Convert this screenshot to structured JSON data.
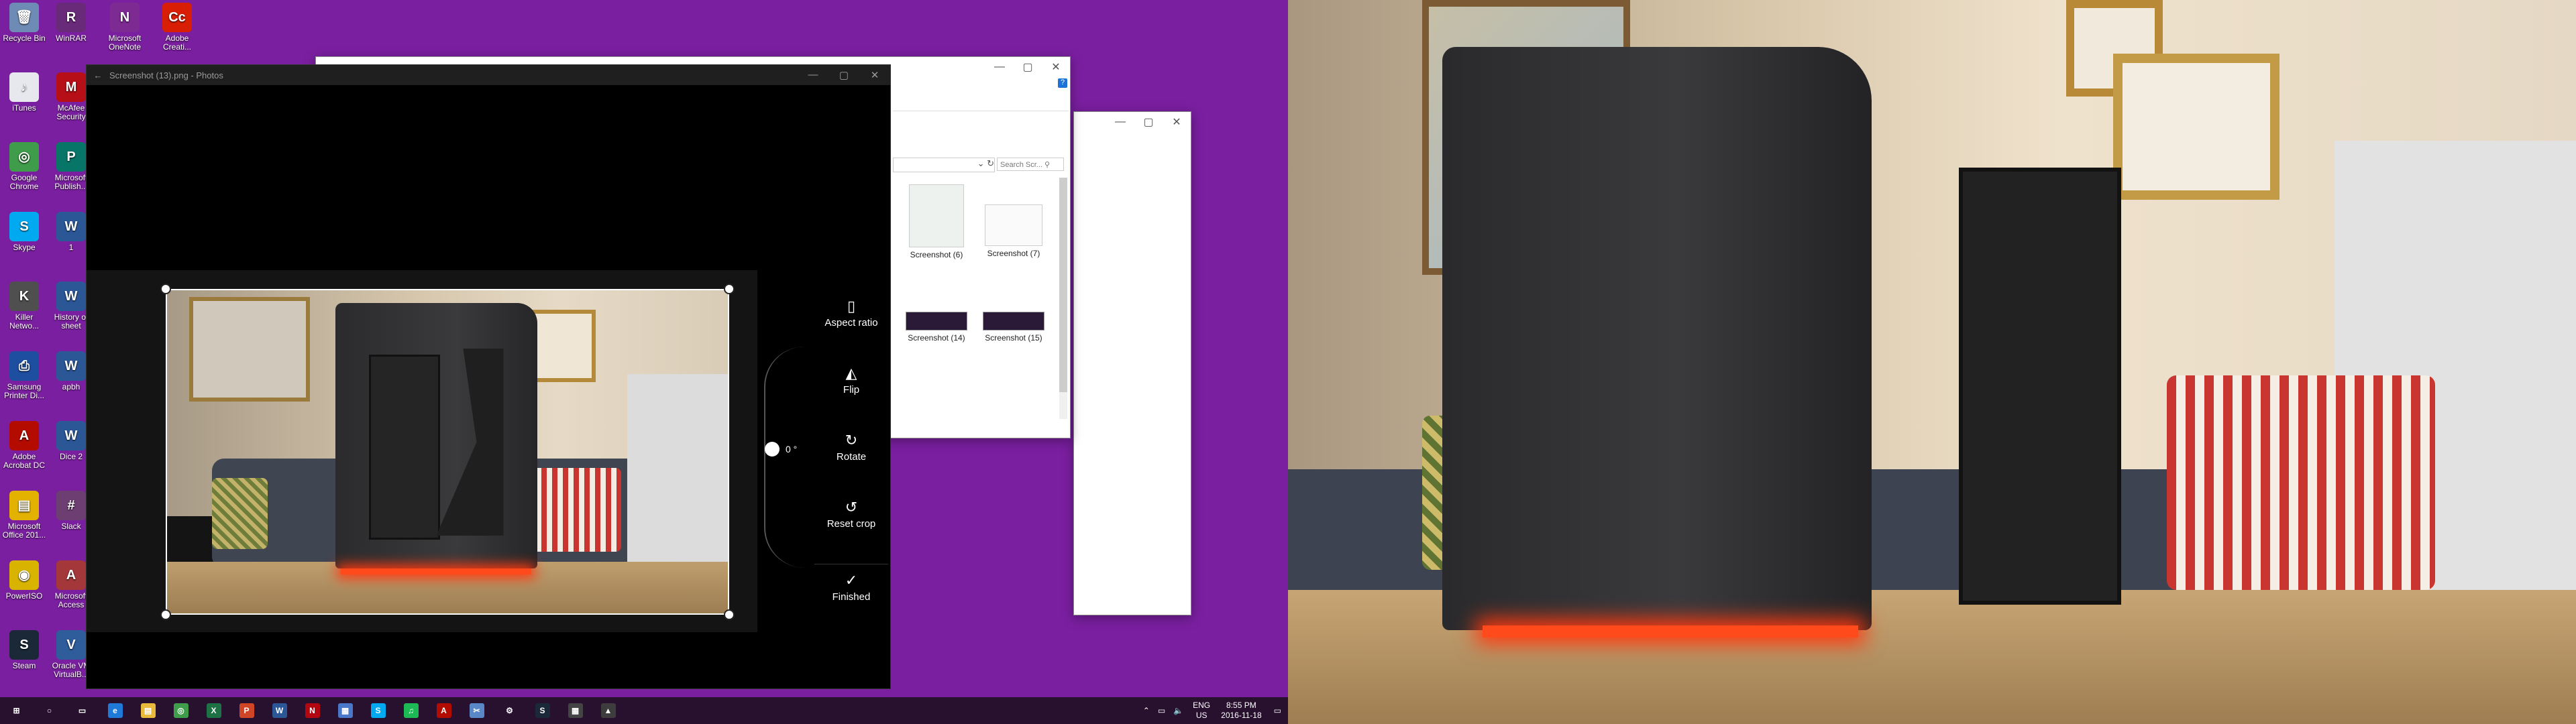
{
  "desktop": {
    "icons": [
      {
        "label": "Recycle Bin",
        "color": "#6d8bb5",
        "glyph": "🗑"
      },
      {
        "label": "WinRAR",
        "color": "#6a2a7a",
        "glyph": "R"
      },
      {
        "label": "Microsoft OneNote",
        "color": "#7d2a92",
        "glyph": "N"
      },
      {
        "label": "Adobe Creati...",
        "color": "#d81e05",
        "glyph": "Cc"
      },
      {
        "label": "iTunes",
        "color": "#e7e7ee",
        "glyph": "♪"
      },
      {
        "label": "McAfee Security",
        "color": "#b70f18",
        "glyph": "M"
      },
      {
        "label": "Google Chrome",
        "color": "#3e9c4a",
        "glyph": "◎"
      },
      {
        "label": "Microsoft Publish...",
        "color": "#077568",
        "glyph": "P"
      },
      {
        "label": "Skype",
        "color": "#00a9f0",
        "glyph": "S"
      },
      {
        "label": "1",
        "color": "#2b5797",
        "glyph": "W"
      },
      {
        "label": "Killer Netwo...",
        "color": "#4f4f4f",
        "glyph": "K"
      },
      {
        "label": "History of sheet",
        "color": "#2b5797",
        "glyph": "W"
      },
      {
        "label": "Samsung Printer Di...",
        "color": "#1e4ea0",
        "glyph": "⎙"
      },
      {
        "label": "apbh",
        "color": "#2b5797",
        "glyph": "W"
      },
      {
        "label": "Adobe Acrobat DC",
        "color": "#b30b00",
        "glyph": "A"
      },
      {
        "label": "Dice 2",
        "color": "#2b5797",
        "glyph": "W"
      },
      {
        "label": "Microsoft Office 201...",
        "color": "#e3b100",
        "glyph": "▤"
      },
      {
        "label": "Slack",
        "color": "#6d3e72",
        "glyph": "#"
      },
      {
        "label": "PowerISO",
        "color": "#d8b400",
        "glyph": "◉"
      },
      {
        "label": "Microsoft Access",
        "color": "#a4373a",
        "glyph": "A"
      },
      {
        "label": "Steam",
        "color": "#1b2838",
        "glyph": "S"
      },
      {
        "label": "Oracle VM VirtualB...",
        "color": "#2f5c9b",
        "glyph": "V"
      }
    ]
  },
  "photos_app": {
    "title": "Screenshot (13).png - Photos",
    "back_icon": "←",
    "min": "—",
    "max": "▢",
    "close": "✕",
    "rotation_value": "0 °",
    "tools": [
      {
        "icon": "▯",
        "label": "Aspect ratio"
      },
      {
        "icon": "◭",
        "label": "Flip"
      },
      {
        "icon": "↻",
        "label": "Rotate"
      },
      {
        "icon": "↺",
        "label": "Reset crop"
      },
      {
        "icon": "✓",
        "label": "Finished"
      }
    ]
  },
  "explorer": {
    "search_placeholder": "Search Scr...",
    "files": [
      {
        "name": "Screenshot (6)"
      },
      {
        "name": "Screenshot (7)"
      },
      {
        "name": "Screenshot (14)"
      },
      {
        "name": "Screenshot (15)"
      }
    ]
  },
  "taskbar": {
    "apps": [
      {
        "name": "start",
        "glyph": "⊞",
        "color": "transparent"
      },
      {
        "name": "cortana",
        "glyph": "○",
        "color": "transparent"
      },
      {
        "name": "task-view",
        "glyph": "▭",
        "color": "transparent"
      },
      {
        "name": "edge",
        "glyph": "e",
        "color": "#1e7ad6"
      },
      {
        "name": "file-explorer",
        "glyph": "▤",
        "color": "#e8b93a"
      },
      {
        "name": "chrome",
        "glyph": "◎",
        "color": "#3e9c4a"
      },
      {
        "name": "excel",
        "glyph": "X",
        "color": "#1e7145"
      },
      {
        "name": "powerpoint",
        "glyph": "P",
        "color": "#d04525"
      },
      {
        "name": "word",
        "glyph": "W",
        "color": "#2b5797"
      },
      {
        "name": "netflix",
        "glyph": "N",
        "color": "#b20710"
      },
      {
        "name": "store",
        "glyph": "▦",
        "color": "#4b77c8"
      },
      {
        "name": "skype",
        "glyph": "S",
        "color": "#00a9f0"
      },
      {
        "name": "spotify",
        "glyph": "♫",
        "color": "#1db954"
      },
      {
        "name": "acrobat",
        "glyph": "A",
        "color": "#b30b00"
      },
      {
        "name": "snipping",
        "glyph": "✂",
        "color": "#5a87c6"
      },
      {
        "name": "settings",
        "glyph": "⚙",
        "color": "transparent"
      },
      {
        "name": "steam",
        "glyph": "S",
        "color": "#1b2838"
      },
      {
        "name": "calculator",
        "glyph": "▦",
        "color": "#444"
      },
      {
        "name": "photos",
        "glyph": "▲",
        "color": "#3d3d3d"
      }
    ],
    "tray": {
      "language": "ENG",
      "region": "US",
      "time": "8:55 PM",
      "date": "2016-11-18"
    }
  }
}
